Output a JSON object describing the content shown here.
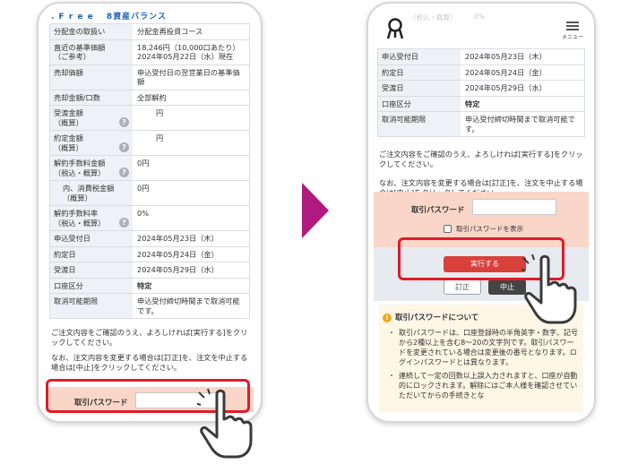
{
  "left": {
    "header": ". F r e e 　8資産バランス",
    "rows": [
      {
        "label": "分配金の取扱い",
        "value": "分配金再投資コース",
        "help": false
      },
      {
        "label": "直近の基準価額\n（ご参考）",
        "value": "18,246円（10,000口あたり）\n2024年05月22日（水）現在",
        "help": false
      },
      {
        "label": "売却価額",
        "value": "申込受付日の翌営業日の基準価額",
        "help": false
      },
      {
        "label": "売却金額/口数",
        "value": "全部解約",
        "help": false
      },
      {
        "label": "受渡金額\n（概算）",
        "value": "円",
        "help": true
      },
      {
        "label": "約定金額\n（概算）",
        "value": "円",
        "help": true
      },
      {
        "label": "解約手数料金額\n（税込・概算）",
        "value": "0円",
        "help": true
      },
      {
        "label": "内、消費税金額\n（概算）",
        "value": "0円",
        "help": false,
        "indent": true
      },
      {
        "label": "解約手数料率\n（税込・概算）",
        "value": "0%",
        "help": true
      },
      {
        "label": "申込受付日",
        "value": "2024年05月23日（木）",
        "help": false
      },
      {
        "label": "約定日",
        "value": "2024年05月24日（金）",
        "help": false
      },
      {
        "label": "受渡日",
        "value": "2024年05月29日（水）",
        "help": false
      },
      {
        "label": "口座区分",
        "value": "特定",
        "help": false,
        "bold": true
      },
      {
        "label": "取消可能期限",
        "value": "申込受付締切時間まで取消可能です。",
        "help": false
      }
    ],
    "note1": "ご注文内容をご確認のうえ、よろしければ[実行する]をクリックしてください。",
    "note2": "なお、注文内容を変更する場合は[訂正]を、注文を中止する場合は[中止]をクリックしてください。",
    "password_label": "取引パスワード"
  },
  "right": {
    "menu_label": "メニュー",
    "top_partial": {
      "label": "（税込・概算）",
      "value": "0%"
    },
    "rows": [
      {
        "label": "申込受付日",
        "value": "2024年05月23日（木）"
      },
      {
        "label": "約定日",
        "value": "2024年05月24日（金）"
      },
      {
        "label": "受渡日",
        "value": "2024年05月29日（水）"
      },
      {
        "label": "口座区分",
        "value": "特定",
        "bold": true
      },
      {
        "label": "取消可能期限",
        "value": "申込受付締切時間まで取消可能です。"
      }
    ],
    "note1": "ご注文内容をご確認のうえ、よろしければ[実行する]をクリックしてください。",
    "note2": "なお、注文内容を変更する場合は[訂正]を、注文を中止する場合は[中止]をクリックしてください。",
    "password_label": "取引パスワード",
    "show_password_label": "取引パスワードを表示",
    "execute_label": "実行する",
    "correct_label": "訂正",
    "cancel_label": "中止",
    "info_title": "取引パスワードについて",
    "info_items": [
      "取引パスワードは、口座登録時の半角英字・数字、記号から2種以上を含む8～20の文字列です。取引パスワードを変更されている場合は変更後の番号となります。ログインパスワードとは異なります。",
      "連続して一定の回数以上誤入力されますと、口座が自動的にロックされます。解除にはご本人様を確認させていただいてからの手続きとな"
    ]
  },
  "colors": {
    "highlight": "#e01b2a",
    "arrow": "#b01a7e",
    "password_band": "#f9d6c7",
    "execute_button": "#d9403a"
  }
}
